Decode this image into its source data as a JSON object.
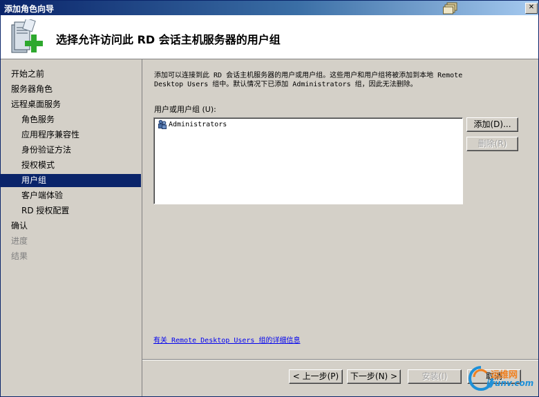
{
  "window": {
    "title": "添加角色向导"
  },
  "header": {
    "title": "选择允许访问此 RD 会话主机服务器的用户组"
  },
  "sidebar": {
    "items": [
      {
        "label": "开始之前",
        "state": "normal",
        "level": 0
      },
      {
        "label": "服务器角色",
        "state": "normal",
        "level": 0
      },
      {
        "label": "远程桌面服务",
        "state": "normal",
        "level": 0
      },
      {
        "label": "角色服务",
        "state": "normal",
        "level": 1
      },
      {
        "label": "应用程序兼容性",
        "state": "normal",
        "level": 1
      },
      {
        "label": "身份验证方法",
        "state": "normal",
        "level": 1
      },
      {
        "label": "授权模式",
        "state": "normal",
        "level": 1
      },
      {
        "label": "用户组",
        "state": "active",
        "level": 1
      },
      {
        "label": "客户端体验",
        "state": "normal",
        "level": 1
      },
      {
        "label": "RD 授权配置",
        "state": "normal",
        "level": 1
      },
      {
        "label": "确认",
        "state": "normal",
        "level": 0
      },
      {
        "label": "进度",
        "state": "disabled",
        "level": 0
      },
      {
        "label": "结果",
        "state": "disabled",
        "level": 0
      }
    ]
  },
  "main": {
    "description_line1": "添加可以连接到此 RD 会话主机服务器的用户或用户组。这些用户和用户组将被添加到本地 Remote",
    "description_line2": "Desktop Users 组中。默认情况下已添加 Administrators 组，因此无法删除。",
    "users_label": "用户或用户组 (U):",
    "users": [
      "Administrators"
    ],
    "add_button": "添加(D)...",
    "remove_button": "删除(R)",
    "more_info_link": "有关 Remote Desktop Users 组的详细信息"
  },
  "footer": {
    "prev_button": "< 上一步(P)",
    "next_button": "下一步(N) >",
    "install_button": "安装(I)",
    "cancel_button": "取消"
  },
  "watermark": {
    "line1": "运维网",
    "line2": "iyunv.com"
  },
  "colors": {
    "titlebar": "#0a246a",
    "selection": "#0a246a",
    "link": "#0000ee",
    "face": "#d4d0c8"
  }
}
